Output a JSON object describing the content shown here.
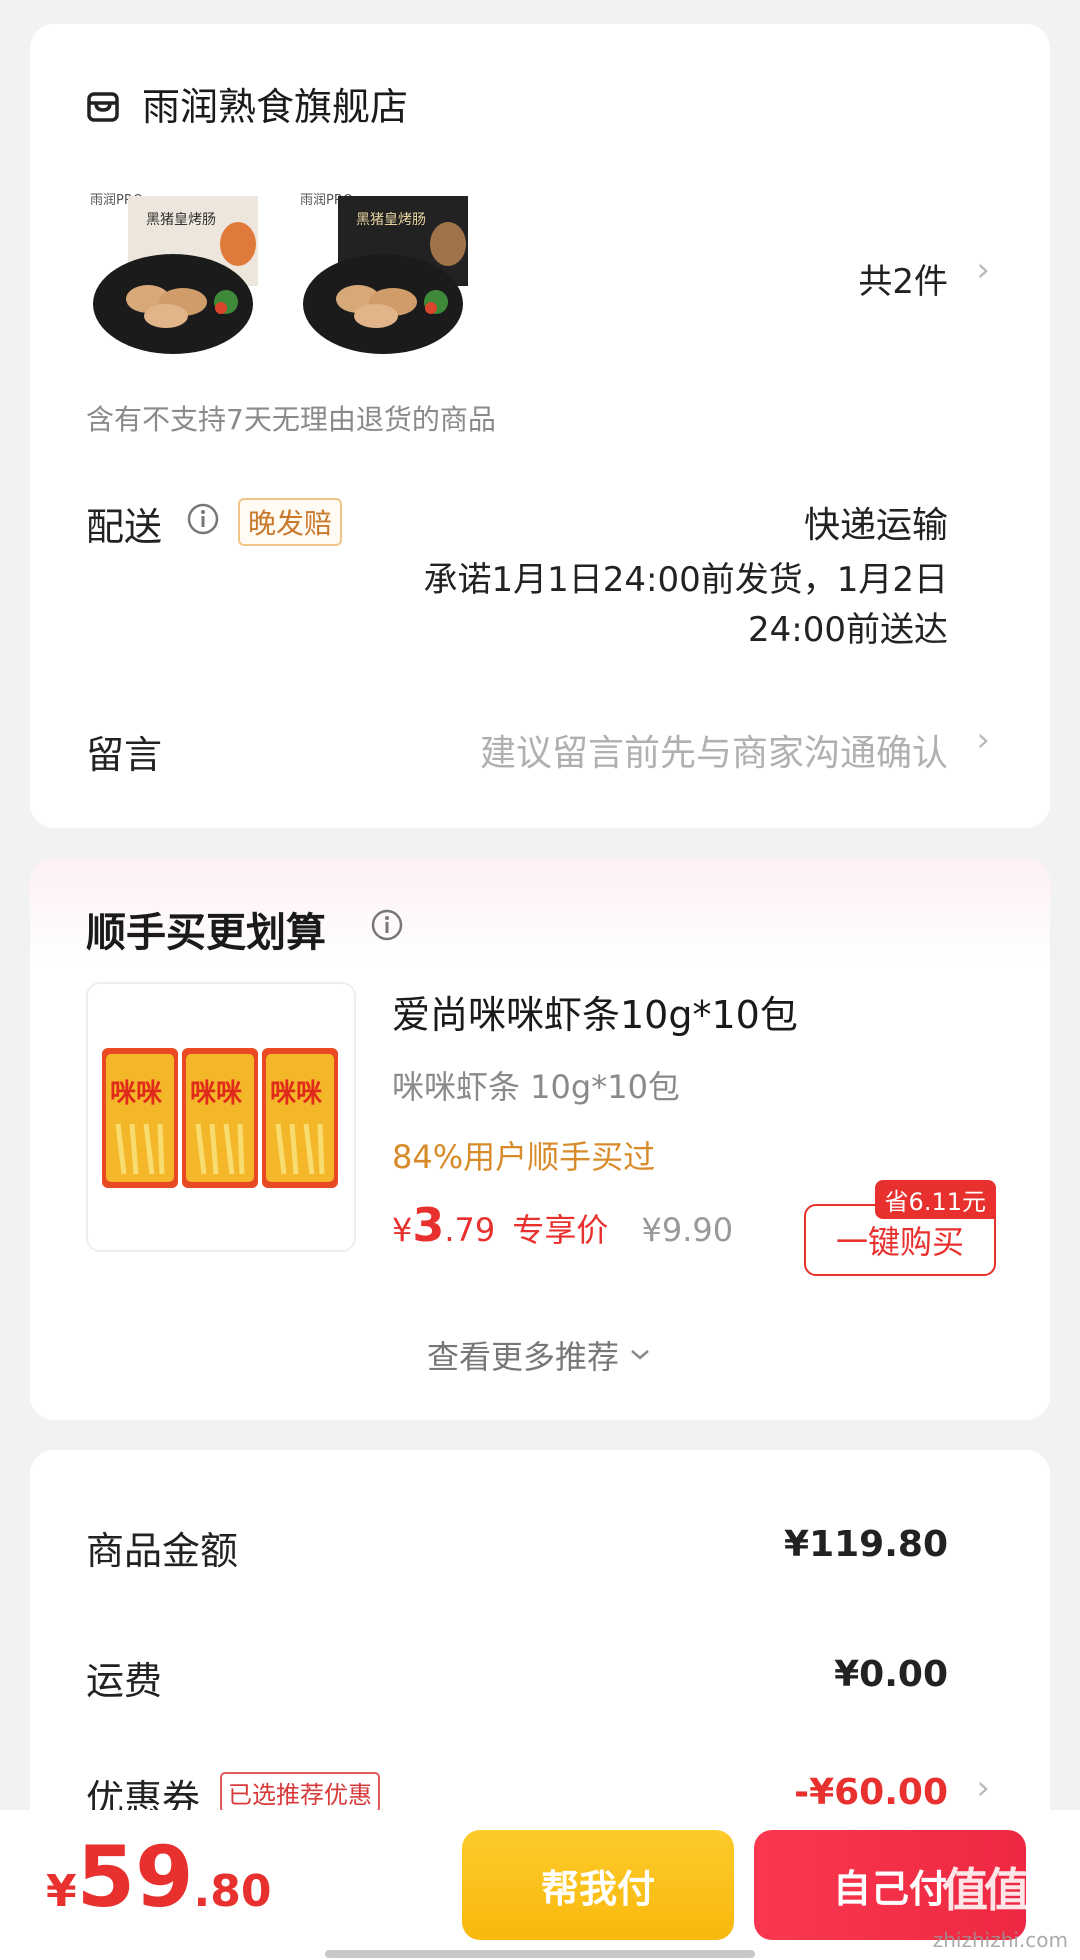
{
  "store": {
    "name": "雨润熟食旗舰店",
    "products": [
      {
        "box_brand": "雨润PRO",
        "box_title": "黑猪皇烤肠",
        "box_color": "#ece6dc",
        "image": "sausage-light-box"
      },
      {
        "box_brand": "雨润PRO",
        "box_title": "黑猪皇烤肠",
        "box_color": "#222222",
        "image": "sausage-dark-box"
      }
    ],
    "count_label": "共2件",
    "return_notice": "含有不支持7天无理由退货的商品"
  },
  "delivery": {
    "label": "配送",
    "badge": "晚发赔",
    "method": "快递运输",
    "promise_line1": "承诺1月1日24:00前发货，1月2日",
    "promise_line2": "24:00前送达"
  },
  "message": {
    "label": "留言",
    "placeholder": "建议留言前先与商家沟通确认"
  },
  "addon": {
    "title": "顺手买更划算",
    "product": {
      "image_text": "咪咪",
      "name": "爱尚咪咪虾条10g*10包",
      "spec": "咪咪虾条 10g*10包",
      "social": "84%用户顺手买过",
      "price_symbol": "¥",
      "price_int": "3",
      "price_dec": ".79",
      "price_label": "专享价",
      "original_price": "¥9.90",
      "save_badge": "省6.11元",
      "buy_button": "一键购买"
    },
    "more": "查看更多推荐"
  },
  "summary": {
    "goods_label": "商品金额",
    "goods_value": "¥119.80",
    "shipping_label": "运费",
    "shipping_value": "¥0.00",
    "coupon_label": "优惠券",
    "coupon_badge": "已选推荐优惠",
    "coupon_value": "-¥60.00"
  },
  "footer": {
    "total_symbol": "¥",
    "total_int": "59",
    "total_dec": ".80",
    "help_pay": "帮我付",
    "self_pay": "自己付"
  },
  "watermark": {
    "logo": "值值值",
    "site": "zhizhizhi.com"
  },
  "colors": {
    "accent_red": "#e8312f",
    "pay_red": "#f5334b",
    "pay_yellow": "#fcc21a",
    "social_orange": "#d88b2a"
  }
}
